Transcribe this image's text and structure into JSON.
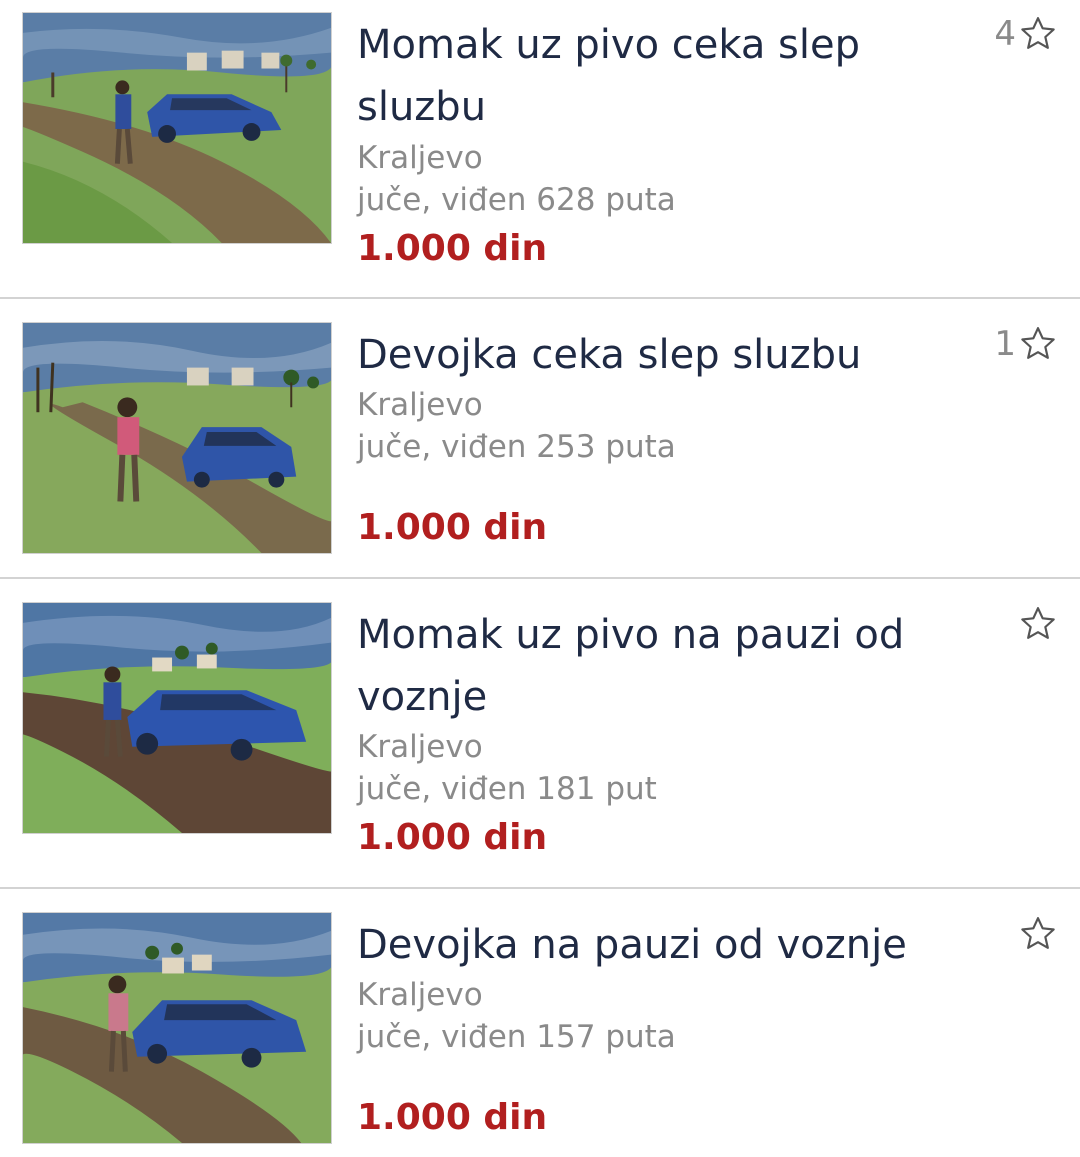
{
  "listings": [
    {
      "title": "Momak uz pivo ceka slep sluzbu",
      "location": "Kraljevo",
      "seen": "juče, viđen 628 puta",
      "price": "1.000 din",
      "favorites": "4",
      "image_icon": "painting-man-with-blue-car-icon"
    },
    {
      "title": "Devojka ceka slep sluzbu",
      "location": "Kraljevo",
      "seen": "juče, viđen 253 puta",
      "price": "1.000 din",
      "favorites": "1",
      "image_icon": "painting-girl-with-blue-car-icon"
    },
    {
      "title": "Momak uz pivo na pauzi od voznje",
      "location": "Kraljevo",
      "seen": "juče, viđen 181 put",
      "price": "1.000 din",
      "favorites": "",
      "image_icon": "painting-man-with-blue-car-icon"
    },
    {
      "title": "Devojka na pauzi od voznje",
      "location": "Kraljevo",
      "seen": "juče, viđen 157 puta",
      "price": "1.000 din",
      "favorites": "",
      "image_icon": "painting-girl-with-blue-car-icon"
    }
  ],
  "colors": {
    "title": "#1f2a44",
    "meta": "#8a8a8a",
    "price": "#b11f1f",
    "divider": "#d3d3d3"
  }
}
